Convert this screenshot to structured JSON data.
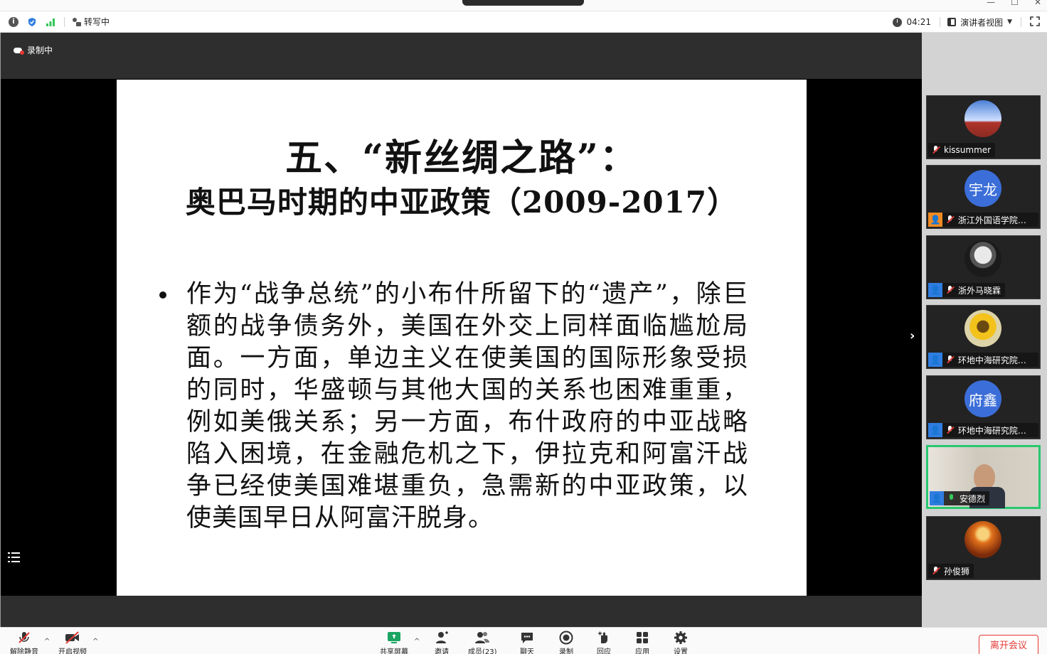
{
  "window": {
    "minimize": "—",
    "maximize": "☐",
    "close": "✕"
  },
  "infobar": {
    "transcribing": "转写中",
    "timer": "04:21",
    "view_mode": "演讲者视图"
  },
  "stage": {
    "recording": "录制中"
  },
  "slide": {
    "title_line1": "五、“新丝绸之路”：",
    "title_line2": "奥巴马时期的中亚政策（2009-2017）",
    "bullet": "作为“战争总统”的小布什所留下的“遗产”，除巨额的战争债务外，美国在外交上同样面临尴尬局面。一方面，单边主义在使美国的国际形象受损的同时，华盛顿与其他大国的关系也困难重重，例如美俄关系；另一方面，布什政府的中亚战略陷入困境，在金融危机之下，伊拉克和阿富汗战争已经使美国难堪重负，急需新的中亚政策，以使美国早日从阿富汗脱身。"
  },
  "participants": [
    {
      "name": "kissummer",
      "avatar_text": "",
      "host_badge": false,
      "muted": true
    },
    {
      "name": "浙江外国语学院—...",
      "avatar_text": "宇龙",
      "host_badge": true,
      "host_color": "#f08a24",
      "muted": true
    },
    {
      "name": "浙外马晓霖",
      "avatar_text": "",
      "host_badge": true,
      "muted": true
    },
    {
      "name": "环地中海研究院梁...",
      "avatar_text": "",
      "host_badge": true,
      "muted": true
    },
    {
      "name": "环地中海研究院杨...",
      "avatar_text": "府鑫",
      "host_badge": true,
      "muted": true
    },
    {
      "name": "安德烈",
      "avatar_text": "",
      "host_badge": true,
      "muted": false,
      "active": true
    },
    {
      "name": "孙俊狮",
      "avatar_text": "",
      "host_badge": false,
      "muted": true
    }
  ],
  "toolbar": {
    "unmute": "解除静音",
    "start_video": "开启视频",
    "share_screen": "共享屏幕",
    "invite": "邀请",
    "members": "成员(23)",
    "chat": "聊天",
    "record": "录制",
    "reactions": "回应",
    "apps": "应用",
    "settings": "设置",
    "leave": "离开会议"
  }
}
